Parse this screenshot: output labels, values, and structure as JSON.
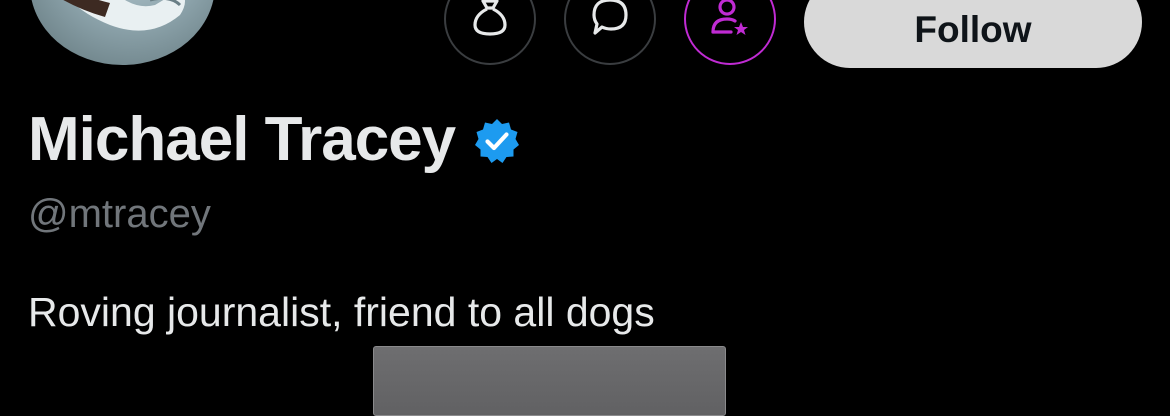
{
  "profile": {
    "display_name": "Michael Tracey",
    "handle": "@mtracey",
    "bio": "Roving journalist, friend to all dogs",
    "verified": true
  },
  "actions": {
    "tip_icon": "money-bag-icon",
    "message_icon": "message-bubble-icon",
    "subscribe_icon": "person-star-icon",
    "follow_label": "Follow"
  },
  "colors": {
    "background": "#000000",
    "primary_text": "#e7e9ea",
    "secondary_text": "#71767b",
    "verified_blue": "#1d9bf0",
    "subscribe_accent": "#c02bd3",
    "follow_button_bg": "#d9d9d9"
  }
}
